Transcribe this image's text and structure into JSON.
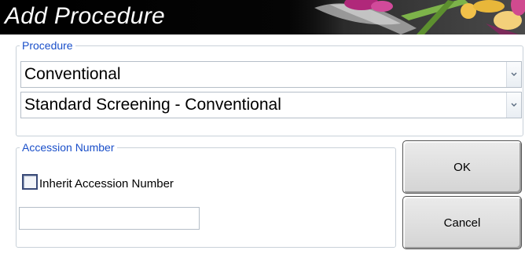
{
  "dialog": {
    "title": "Add Procedure"
  },
  "procedure_group": {
    "legend": "Procedure",
    "type_value": "Conventional",
    "procedure_value": "Standard Screening - Conventional"
  },
  "accession_group": {
    "legend": "Accession Number",
    "inherit_label": "Inherit Accession Number",
    "inherit_checked": false,
    "accession_value": ""
  },
  "buttons": {
    "ok_label": "OK",
    "cancel_label": "Cancel"
  },
  "colors": {
    "legend_blue": "#1a4fc9",
    "titlebar": "#000000",
    "button_face": "#dedede"
  },
  "icons": [
    "dropdown-arrow-icon",
    "flower-banner-image"
  ]
}
